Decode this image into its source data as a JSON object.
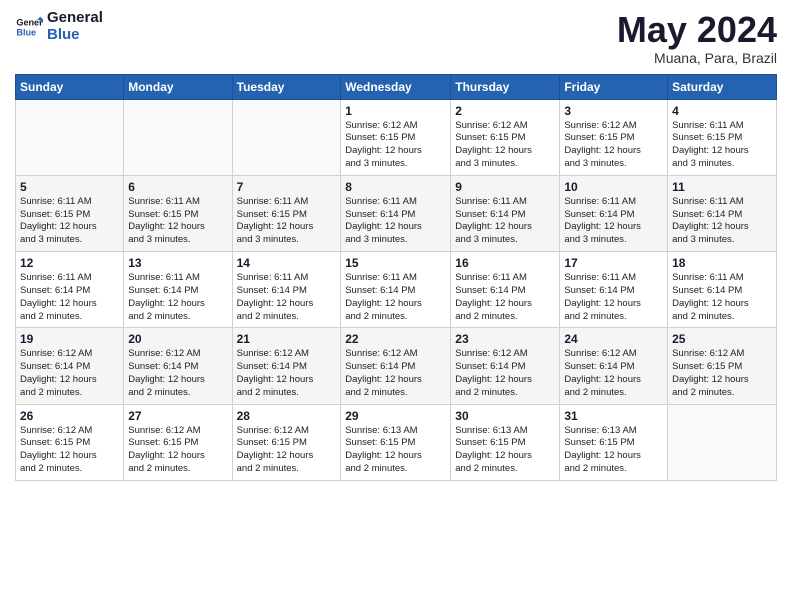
{
  "logo": {
    "line1": "General",
    "line2": "Blue"
  },
  "title": "May 2024",
  "subtitle": "Muana, Para, Brazil",
  "days_header": [
    "Sunday",
    "Monday",
    "Tuesday",
    "Wednesday",
    "Thursday",
    "Friday",
    "Saturday"
  ],
  "weeks": [
    [
      {
        "day": "",
        "info": ""
      },
      {
        "day": "",
        "info": ""
      },
      {
        "day": "",
        "info": ""
      },
      {
        "day": "1",
        "info": "Sunrise: 6:12 AM\nSunset: 6:15 PM\nDaylight: 12 hours\nand 3 minutes."
      },
      {
        "day": "2",
        "info": "Sunrise: 6:12 AM\nSunset: 6:15 PM\nDaylight: 12 hours\nand 3 minutes."
      },
      {
        "day": "3",
        "info": "Sunrise: 6:12 AM\nSunset: 6:15 PM\nDaylight: 12 hours\nand 3 minutes."
      },
      {
        "day": "4",
        "info": "Sunrise: 6:11 AM\nSunset: 6:15 PM\nDaylight: 12 hours\nand 3 minutes."
      }
    ],
    [
      {
        "day": "5",
        "info": "Sunrise: 6:11 AM\nSunset: 6:15 PM\nDaylight: 12 hours\nand 3 minutes."
      },
      {
        "day": "6",
        "info": "Sunrise: 6:11 AM\nSunset: 6:15 PM\nDaylight: 12 hours\nand 3 minutes."
      },
      {
        "day": "7",
        "info": "Sunrise: 6:11 AM\nSunset: 6:15 PM\nDaylight: 12 hours\nand 3 minutes."
      },
      {
        "day": "8",
        "info": "Sunrise: 6:11 AM\nSunset: 6:14 PM\nDaylight: 12 hours\nand 3 minutes."
      },
      {
        "day": "9",
        "info": "Sunrise: 6:11 AM\nSunset: 6:14 PM\nDaylight: 12 hours\nand 3 minutes."
      },
      {
        "day": "10",
        "info": "Sunrise: 6:11 AM\nSunset: 6:14 PM\nDaylight: 12 hours\nand 3 minutes."
      },
      {
        "day": "11",
        "info": "Sunrise: 6:11 AM\nSunset: 6:14 PM\nDaylight: 12 hours\nand 3 minutes."
      }
    ],
    [
      {
        "day": "12",
        "info": "Sunrise: 6:11 AM\nSunset: 6:14 PM\nDaylight: 12 hours\nand 2 minutes."
      },
      {
        "day": "13",
        "info": "Sunrise: 6:11 AM\nSunset: 6:14 PM\nDaylight: 12 hours\nand 2 minutes."
      },
      {
        "day": "14",
        "info": "Sunrise: 6:11 AM\nSunset: 6:14 PM\nDaylight: 12 hours\nand 2 minutes."
      },
      {
        "day": "15",
        "info": "Sunrise: 6:11 AM\nSunset: 6:14 PM\nDaylight: 12 hours\nand 2 minutes."
      },
      {
        "day": "16",
        "info": "Sunrise: 6:11 AM\nSunset: 6:14 PM\nDaylight: 12 hours\nand 2 minutes."
      },
      {
        "day": "17",
        "info": "Sunrise: 6:11 AM\nSunset: 6:14 PM\nDaylight: 12 hours\nand 2 minutes."
      },
      {
        "day": "18",
        "info": "Sunrise: 6:11 AM\nSunset: 6:14 PM\nDaylight: 12 hours\nand 2 minutes."
      }
    ],
    [
      {
        "day": "19",
        "info": "Sunrise: 6:12 AM\nSunset: 6:14 PM\nDaylight: 12 hours\nand 2 minutes."
      },
      {
        "day": "20",
        "info": "Sunrise: 6:12 AM\nSunset: 6:14 PM\nDaylight: 12 hours\nand 2 minutes."
      },
      {
        "day": "21",
        "info": "Sunrise: 6:12 AM\nSunset: 6:14 PM\nDaylight: 12 hours\nand 2 minutes."
      },
      {
        "day": "22",
        "info": "Sunrise: 6:12 AM\nSunset: 6:14 PM\nDaylight: 12 hours\nand 2 minutes."
      },
      {
        "day": "23",
        "info": "Sunrise: 6:12 AM\nSunset: 6:14 PM\nDaylight: 12 hours\nand 2 minutes."
      },
      {
        "day": "24",
        "info": "Sunrise: 6:12 AM\nSunset: 6:14 PM\nDaylight: 12 hours\nand 2 minutes."
      },
      {
        "day": "25",
        "info": "Sunrise: 6:12 AM\nSunset: 6:15 PM\nDaylight: 12 hours\nand 2 minutes."
      }
    ],
    [
      {
        "day": "26",
        "info": "Sunrise: 6:12 AM\nSunset: 6:15 PM\nDaylight: 12 hours\nand 2 minutes."
      },
      {
        "day": "27",
        "info": "Sunrise: 6:12 AM\nSunset: 6:15 PM\nDaylight: 12 hours\nand 2 minutes."
      },
      {
        "day": "28",
        "info": "Sunrise: 6:12 AM\nSunset: 6:15 PM\nDaylight: 12 hours\nand 2 minutes."
      },
      {
        "day": "29",
        "info": "Sunrise: 6:13 AM\nSunset: 6:15 PM\nDaylight: 12 hours\nand 2 minutes."
      },
      {
        "day": "30",
        "info": "Sunrise: 6:13 AM\nSunset: 6:15 PM\nDaylight: 12 hours\nand 2 minutes."
      },
      {
        "day": "31",
        "info": "Sunrise: 6:13 AM\nSunset: 6:15 PM\nDaylight: 12 hours\nand 2 minutes."
      },
      {
        "day": "",
        "info": ""
      }
    ]
  ]
}
